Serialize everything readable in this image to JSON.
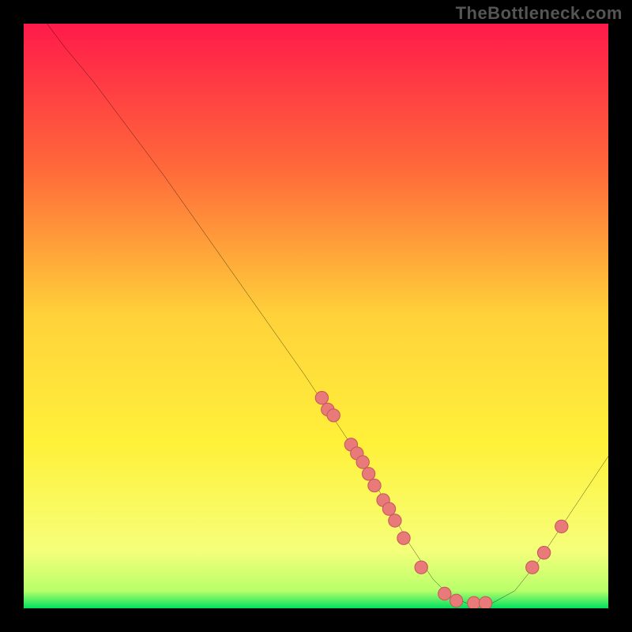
{
  "watermark": "TheBottleneck.com",
  "colors": {
    "gradient": [
      "#ff1a4a",
      "#ff6a3a",
      "#ffd23a",
      "#fff13a",
      "#f6ff7a",
      "#b8ff6a",
      "#00e060"
    ],
    "gradient_offsets": [
      0,
      25,
      50,
      72,
      90,
      97,
      100
    ],
    "line": "#000000",
    "dots": "#e87a7a",
    "dots_stroke": "#c85a5a"
  },
  "chart_data": {
    "type": "line",
    "title": "",
    "xlabel": "",
    "ylabel": "",
    "xlim": [
      0,
      100
    ],
    "ylim": [
      0,
      100
    ],
    "curve": [
      {
        "x": 4,
        "y": 100
      },
      {
        "x": 7,
        "y": 96
      },
      {
        "x": 12,
        "y": 90
      },
      {
        "x": 18,
        "y": 82
      },
      {
        "x": 24,
        "y": 74
      },
      {
        "x": 30,
        "y": 65.5
      },
      {
        "x": 36,
        "y": 57
      },
      {
        "x": 42,
        "y": 48.5
      },
      {
        "x": 48,
        "y": 40
      },
      {
        "x": 54,
        "y": 31
      },
      {
        "x": 58,
        "y": 25
      },
      {
        "x": 62,
        "y": 18
      },
      {
        "x": 66,
        "y": 11
      },
      {
        "x": 70,
        "y": 5
      },
      {
        "x": 73,
        "y": 2
      },
      {
        "x": 76,
        "y": 0.8
      },
      {
        "x": 80,
        "y": 0.8
      },
      {
        "x": 84,
        "y": 3
      },
      {
        "x": 88,
        "y": 8
      },
      {
        "x": 92,
        "y": 14
      },
      {
        "x": 96,
        "y": 20
      },
      {
        "x": 100,
        "y": 26
      }
    ],
    "dots": [
      {
        "x": 51,
        "y": 36
      },
      {
        "x": 52,
        "y": 34
      },
      {
        "x": 53,
        "y": 33
      },
      {
        "x": 56,
        "y": 28
      },
      {
        "x": 57,
        "y": 26.5
      },
      {
        "x": 58,
        "y": 25
      },
      {
        "x": 59,
        "y": 23
      },
      {
        "x": 60,
        "y": 21
      },
      {
        "x": 61.5,
        "y": 18.5
      },
      {
        "x": 62.5,
        "y": 17
      },
      {
        "x": 63.5,
        "y": 15
      },
      {
        "x": 65,
        "y": 12
      },
      {
        "x": 68,
        "y": 7
      },
      {
        "x": 72,
        "y": 2.5
      },
      {
        "x": 74,
        "y": 1.3
      },
      {
        "x": 77,
        "y": 0.9
      },
      {
        "x": 79,
        "y": 0.9
      },
      {
        "x": 87,
        "y": 7
      },
      {
        "x": 89,
        "y": 9.5
      },
      {
        "x": 92,
        "y": 14
      }
    ]
  }
}
